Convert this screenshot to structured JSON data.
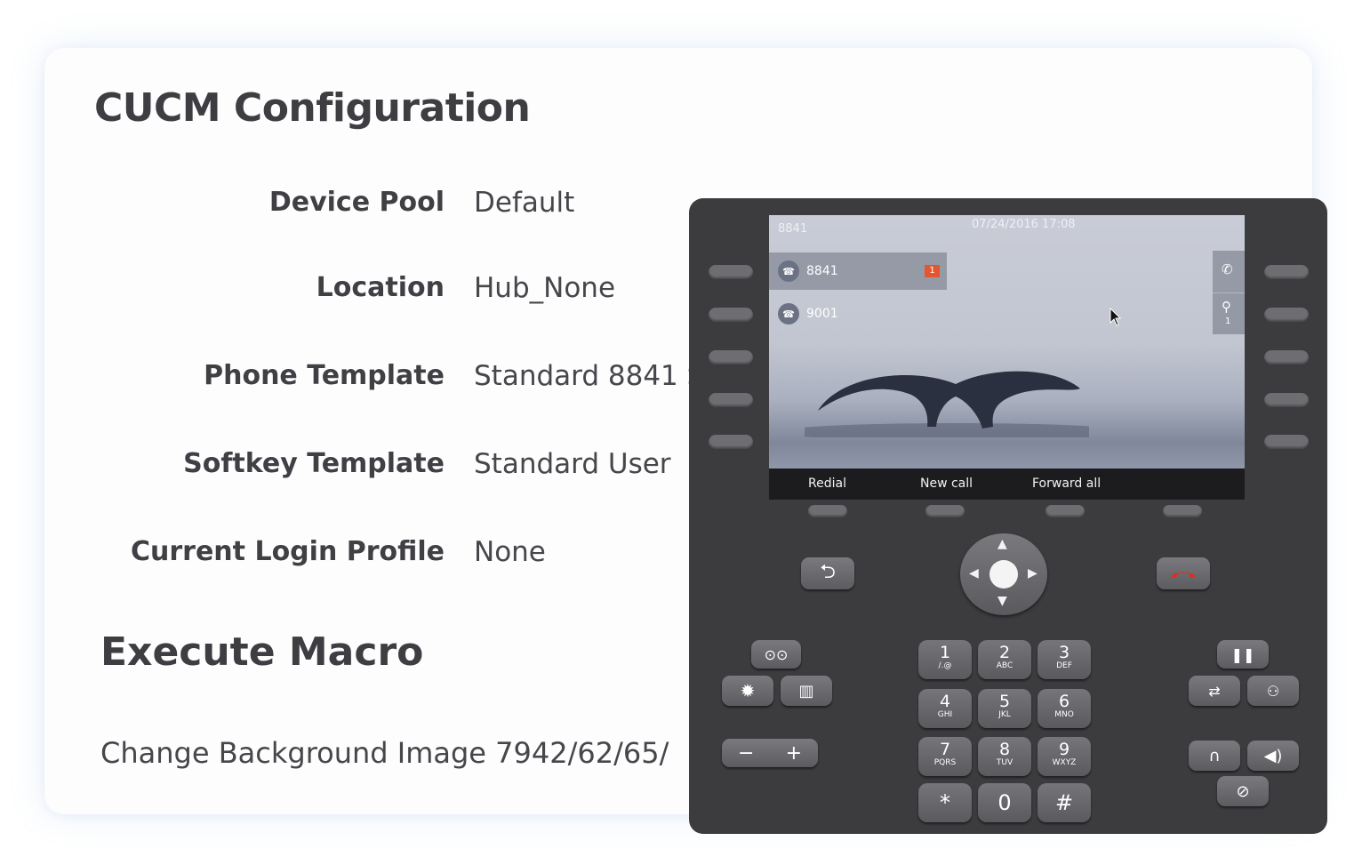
{
  "config": {
    "title": "CUCM Configuration",
    "rows": [
      {
        "label": "Device Pool",
        "value": "Default"
      },
      {
        "label": "Location",
        "value": "Hub_None"
      },
      {
        "label": "Phone Template",
        "value": "Standard 8841 S"
      },
      {
        "label": "Softkey Template",
        "value": "Standard User"
      },
      {
        "label": "Current Login Profile",
        "value": "None"
      }
    ]
  },
  "macro": {
    "title": "Execute Macro",
    "item": "Change Background Image 7942/62/65/"
  },
  "phone": {
    "screen": {
      "header_line": "8841",
      "datetime": "07/24/2016 17:08",
      "lines": [
        {
          "number": "8841",
          "badge": "1"
        },
        {
          "number": "9001"
        }
      ],
      "right_tab_count": "1",
      "softkeys": [
        "Redial",
        "New call",
        "Forward all"
      ]
    },
    "keypad": [
      {
        "digit": "1",
        "letters": "/.@"
      },
      {
        "digit": "2",
        "letters": "ABC"
      },
      {
        "digit": "3",
        "letters": "DEF"
      },
      {
        "digit": "4",
        "letters": "GHI"
      },
      {
        "digit": "5",
        "letters": "JKL"
      },
      {
        "digit": "6",
        "letters": "MNO"
      },
      {
        "digit": "7",
        "letters": "PQRS"
      },
      {
        "digit": "8",
        "letters": "TUV"
      },
      {
        "digit": "9",
        "letters": "WXYZ"
      },
      {
        "digit": "*",
        "letters": ""
      },
      {
        "digit": "0",
        "letters": ""
      },
      {
        "digit": "#",
        "letters": ""
      }
    ],
    "volume": {
      "minus": "−",
      "plus": "+"
    },
    "colors": {
      "body": "#3c3c3e",
      "end_call": "#e02b20",
      "badge": "#e4572e"
    }
  }
}
